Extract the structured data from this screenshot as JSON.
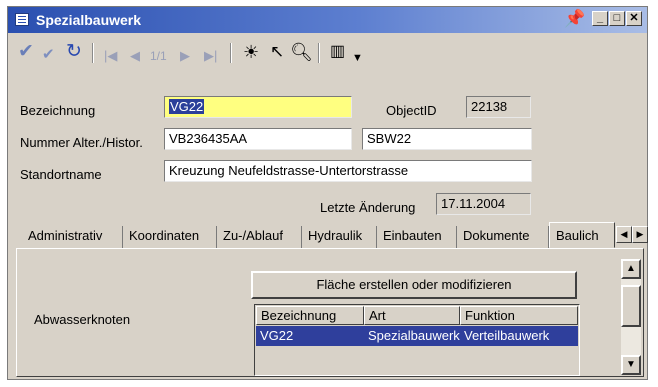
{
  "window": {
    "title": "Spezialbauwerk"
  },
  "toolbar": {
    "pager": "1/1"
  },
  "form": {
    "bezeichnung_label": "Bezeichnung",
    "bezeichnung_value": "VG22",
    "objectid_label": "ObjectID",
    "objectid_value": "22138",
    "nummer_label": "Nummer Alter./Histor.",
    "nummer_value1": "VB236435AA",
    "nummer_value2": "SBW22",
    "standort_label": "Standortname",
    "standort_value": "Kreuzung Neufeldstrasse-Untertorstrasse",
    "letzte_label": "Letzte Änderung",
    "letzte_value": "17.11.2004"
  },
  "tabs": [
    "Administrativ",
    "Koordinaten",
    "Zu-/Ablauf",
    "Hydraulik",
    "Einbauten",
    "Dokumente",
    "Baulich"
  ],
  "panel": {
    "button_label": "Fläche erstellen oder modifizieren",
    "section_label": "Abwasserknoten",
    "table": {
      "headers": [
        "Bezeichnung",
        "Art",
        "Funktion"
      ],
      "rows": [
        [
          "VG22",
          "Spezialbauwerk",
          "Verteilbauwerk"
        ]
      ]
    }
  }
}
